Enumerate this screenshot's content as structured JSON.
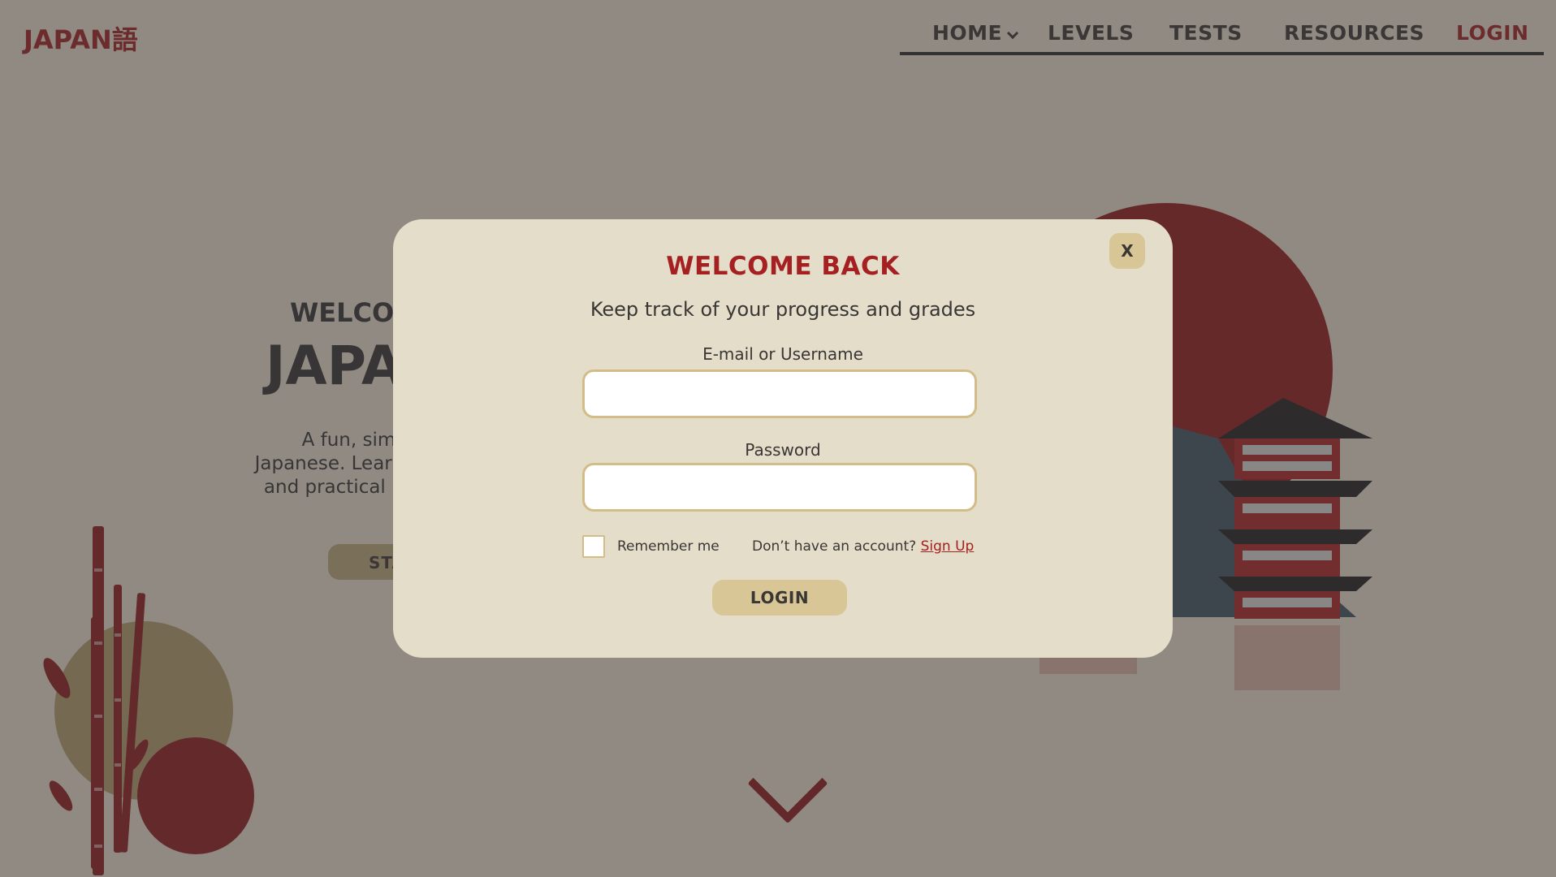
{
  "header": {
    "logo": "JAPAN語",
    "nav": {
      "home": "HOME",
      "levels": "LEVELS",
      "tests": "TESTS",
      "resources": "RESOURCES",
      "login": "LOGIN"
    }
  },
  "hero": {
    "kicker": "WELCO",
    "title": "JAPA",
    "description_line1": "A fun, simple and f",
    "description_line2": "Japanese. Learn at your",
    "description_line3": "and practical languag",
    "button": "STA"
  },
  "modal": {
    "close_label": "X",
    "title": "WELCOME BACK",
    "subtitle": "Keep track of your progress and grades",
    "username_label": "E-mail or Username",
    "username_value": "",
    "password_label": "Password",
    "password_value": "",
    "remember_label": "Remember me",
    "remember_checked": false,
    "signup_prompt": "Don’t have an account?",
    "signup_link": "Sign Up",
    "login_button": "LOGIN"
  },
  "colors": {
    "brand_red": "#a52020",
    "background_cream": "#e4ddca",
    "button_tan": "#d8c697",
    "input_border": "#d2bd89",
    "overlay": "rgba(60,55,58,0.5)"
  },
  "icons": {
    "home_dropdown": "chevron-down-icon",
    "scroll_down": "chevron-down-icon",
    "close": "close-icon"
  }
}
